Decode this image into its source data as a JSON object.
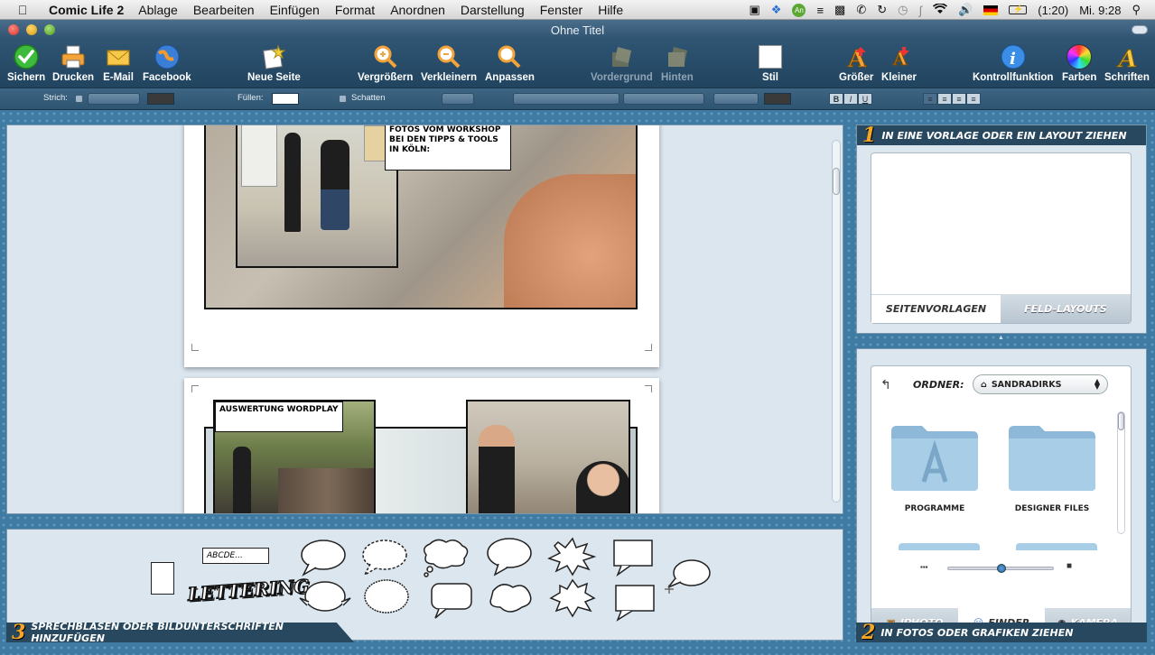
{
  "menubar": {
    "app_name": "Comic Life 2",
    "menus": [
      "Ablage",
      "Bearbeiten",
      "Einfügen",
      "Format",
      "Anordnen",
      "Darstellung",
      "Fenster",
      "Hilfe"
    ],
    "battery": "(1:20)",
    "clock": "Mi. 9:28"
  },
  "window": {
    "title": "Ohne Titel"
  },
  "toolbar": {
    "save": "Sichern",
    "print": "Drucken",
    "email": "E-Mail",
    "facebook": "Facebook",
    "new_page": "Neue Seite",
    "zoom_in": "Vergrößern",
    "zoom_out": "Verkleinern",
    "fit": "Anpassen",
    "foreground": "Vordergrund",
    "background": "Hinten",
    "style": "Stil",
    "bigger": "Größer",
    "smaller": "Kleiner",
    "inspector": "Kontrollfunktion",
    "colors": "Farben",
    "fonts": "Schriften"
  },
  "formatbar": {
    "stroke_label": "Strich:",
    "fill_label": "Füllen:",
    "shadow_label": "Schatten",
    "bold": "B",
    "italic": "I",
    "underline": "U"
  },
  "canvas": {
    "caption1": "Fotos vom Workshop bei den Tipps & Tools in Köln:",
    "caption2": "Auswertung Wordplay"
  },
  "bubbles": {
    "lettering_sample": "ABCDE...",
    "lettering_logo": "LETTERING",
    "hint": "Sprechblasen oder Bildunterschriften hinzufügen",
    "step": "3"
  },
  "templates_panel": {
    "step": "1",
    "header": "In eine Vorlage oder ein Layout ziehen",
    "tab_templates": "Seitenvorlagen",
    "tab_layouts": "Feld-Layouts"
  },
  "photos_panel": {
    "step": "2",
    "folder_label": "Ordner:",
    "folder_value": "sandradirks",
    "items": [
      "Programme",
      "Designer Files"
    ],
    "tab_iphoto": "iPhoto",
    "tab_finder": "Finder",
    "tab_camera": "Kamera",
    "hint": "In Fotos oder Grafiken ziehen"
  },
  "colors": {
    "accent_orange": "#f6a623",
    "panel_blue": "#28485f"
  }
}
